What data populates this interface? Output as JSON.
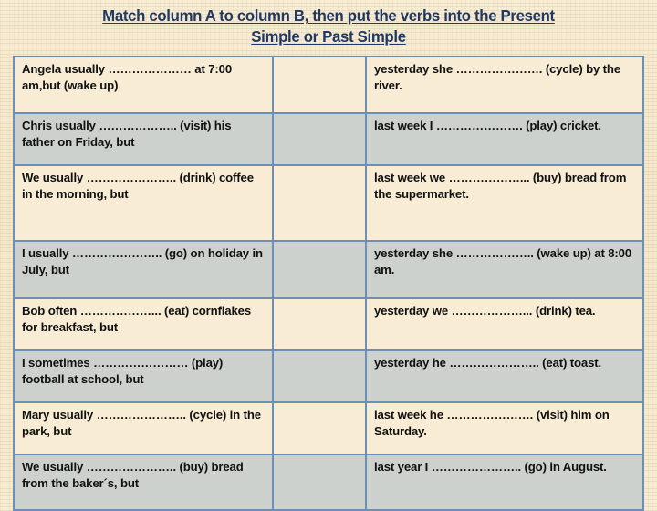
{
  "title": {
    "line1": "Match column A to column B, then put the verbs into the Present",
    "line2": "Simple or Past Simple",
    "color": "#1f3864"
  },
  "colors": {
    "page_background": "#f3e6c9",
    "row_cream": "#f8edd4",
    "row_gray": "#ccd1cd",
    "border": "#6b8fb5",
    "text": "#111111",
    "title": "#1f3864"
  },
  "table": {
    "column_count": 3,
    "middle_column_is_blank_answer_space": true,
    "rows": [
      {
        "band": "cream",
        "column_a": "Angela usually ………………… at 7:00 am,but  (wake up)",
        "column_middle": "",
        "column_b": "yesterday  she …………………. (cycle) by the river."
      },
      {
        "band": "gray",
        "column_a": "Chris usually ………………..  (visit) his father on Friday, but",
        "column_middle": "",
        "column_b": "last week I …………………. (play) cricket."
      },
      {
        "band": "cream",
        "column_a": "We usually ………………….. (drink) coffee in the morning, but",
        "column_middle": "",
        "column_b": "last week we ………………... (buy) bread from the supermarket."
      },
      {
        "band": "gray",
        "column_a": "I usually …………………..  (go) on holiday in July, but",
        "column_middle": "",
        "column_b": "yesterday she ……………….. (wake up)  at 8:00 am."
      },
      {
        "band": "cream",
        "column_a": "Bob often ………………... (eat) cornflakes for breakfast, but",
        "column_middle": "",
        "column_b": "yesterday  we ………………... (drink) tea."
      },
      {
        "band": "gray",
        "column_a": "I sometimes ……………………  (play) football at school, but",
        "column_middle": "",
        "column_b": "yesterday  he ………………….. (eat) toast."
      },
      {
        "band": "cream",
        "column_a": "Mary usually …………………..  (cycle) in the park, but",
        "column_middle": "",
        "column_b": "last week he …………………. (visit) him on Saturday."
      },
      {
        "band": "gray",
        "column_a": "We usually ………………….. (buy) bread from the baker´s, but",
        "column_middle": "",
        "column_b": "last year  I ………………….. (go)  in August."
      }
    ]
  }
}
